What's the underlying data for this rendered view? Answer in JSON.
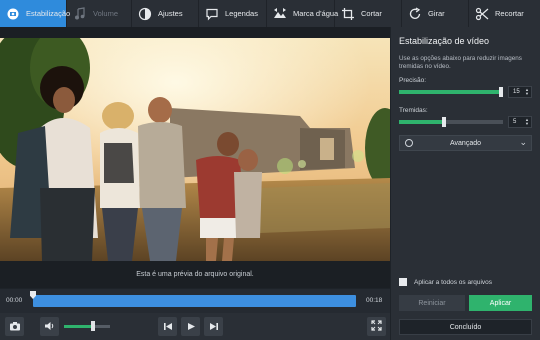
{
  "toolbar": {
    "tools": [
      {
        "label": "Estabilização",
        "icon": "stabilize-icon",
        "state": "active"
      },
      {
        "label": "Volume",
        "icon": "music-note-icon",
        "state": "disabled"
      },
      {
        "label": "Ajustes",
        "icon": "contrast-icon",
        "state": "normal"
      },
      {
        "label": "Legendas",
        "icon": "subtitle-icon",
        "state": "normal"
      },
      {
        "label": "Marca d'água",
        "icon": "watermark-icon",
        "state": "normal"
      },
      {
        "label": "Cortar",
        "icon": "crop-icon",
        "state": "normal"
      },
      {
        "label": "Girar",
        "icon": "rotate-icon",
        "state": "normal"
      },
      {
        "label": "Recortar",
        "icon": "scissors-icon",
        "state": "normal"
      }
    ]
  },
  "preview": {
    "caption": "Esta é uma prévia do arquivo original."
  },
  "timeline": {
    "start_time": "00:00",
    "end_time": "00:18",
    "playhead_fraction": 0.0
  },
  "controls": {
    "volume_fraction": 0.62,
    "icons": [
      "camera-icon",
      "speaker-icon",
      "skip-back-icon",
      "play-icon",
      "skip-forward-icon",
      "fullscreen-icon"
    ]
  },
  "panel": {
    "title": "Estabilização de vídeo",
    "description": "Use as opções abaixo para reduzir imagens tremidas no vídeo.",
    "precision": {
      "label": "Precisão:",
      "value": "15",
      "fraction": 1.0
    },
    "shakiness": {
      "label": "Tremidas:",
      "value": "5",
      "fraction": 0.45
    },
    "advanced_label": "Avançado",
    "apply_all_label": "Aplicar a todos os arquivos",
    "reset_label": "Reiniciar",
    "apply_label": "Aplicar",
    "done_label": "Concluído"
  },
  "colors": {
    "accent_blue": "#2f8bdc",
    "accent_green": "#2fb36d",
    "panel_bg": "#2a2f36"
  }
}
